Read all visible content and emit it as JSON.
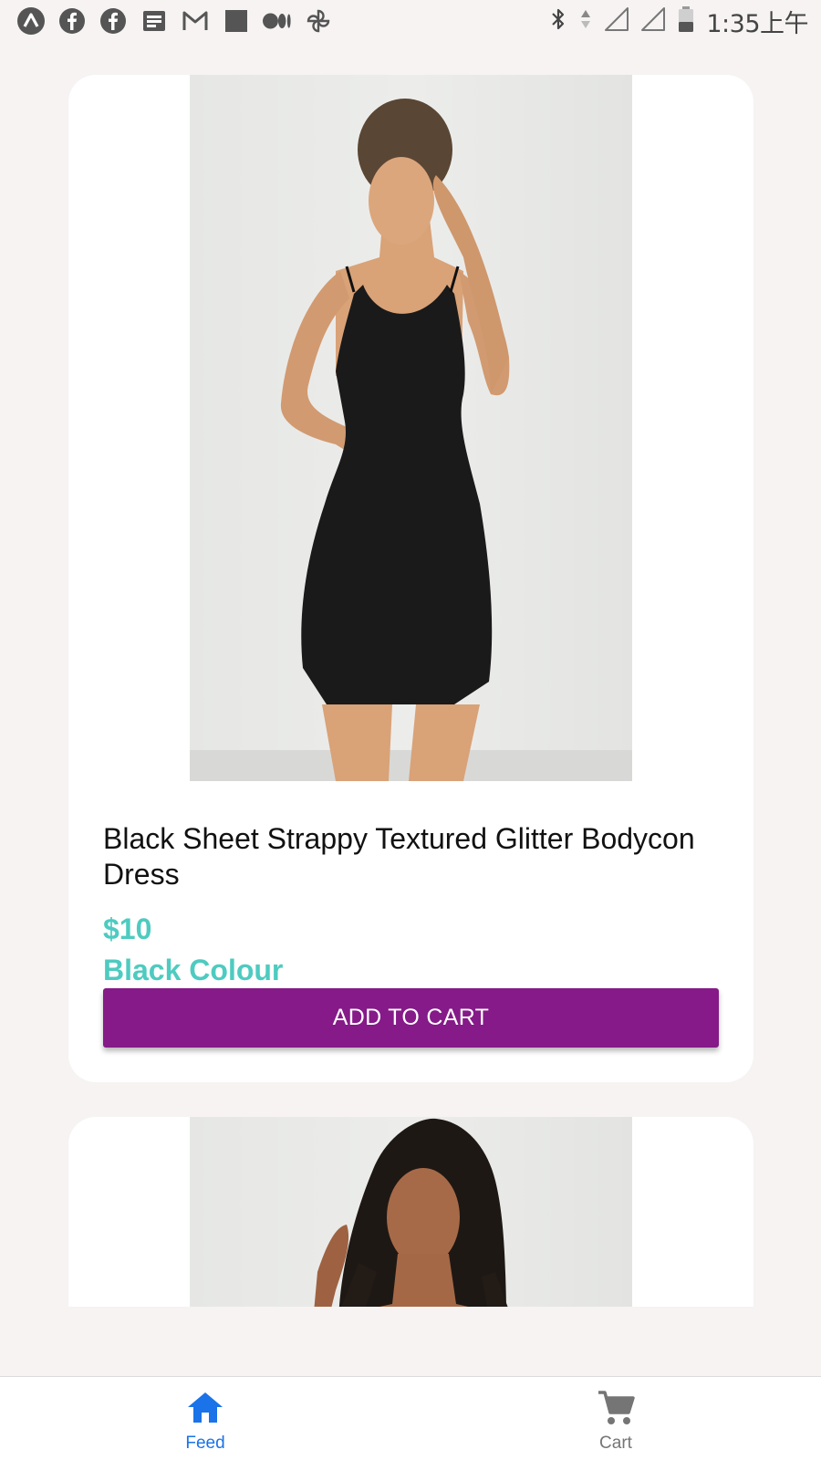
{
  "status_bar": {
    "time": "1:35上午",
    "left_icons": [
      "app-a-icon",
      "facebook-icon",
      "facebook-icon",
      "news-icon",
      "gmail-icon",
      "square-icon",
      "medium-icon",
      "pinwheel-icon"
    ],
    "right_icons": [
      "bluetooth-icon",
      "data-arrows-icon",
      "signal-icon",
      "signal-icon",
      "battery-icon"
    ]
  },
  "feed": {
    "products": [
      {
        "title": "Black Sheet Strappy Textured Glitter Bodycon Dress",
        "price": "$10",
        "colour": "Black Colour",
        "button_label": "ADD TO CART"
      }
    ]
  },
  "tab_bar": {
    "tabs": [
      {
        "label": "Feed",
        "icon": "home-icon",
        "active": true
      },
      {
        "label": "Cart",
        "icon": "cart-icon",
        "active": false
      }
    ]
  },
  "colors": {
    "background": "#f6f3f2",
    "accent_teal": "#4ecbc0",
    "button_purple": "#851a88",
    "tab_active": "#1a73e8",
    "tab_inactive": "#757575"
  }
}
